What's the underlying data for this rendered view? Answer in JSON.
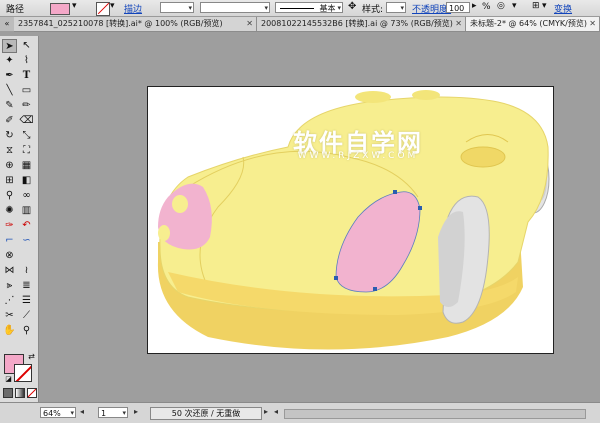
{
  "control_bar": {
    "mode_label": "路径",
    "stroke_label": "描边",
    "stroke_weight": "",
    "brush_label": "基本",
    "style_label": "样式:",
    "opacity_label": "不透明度:",
    "opacity_value": "100",
    "opacity_unit": "%",
    "transform_label": "变换"
  },
  "tabs": [
    {
      "label": "2357841_025210078 [转换].ai* @ 100% (RGB/预览)",
      "active": false
    },
    {
      "label": "20081022145532B6 [转换].ai @ 73% (RGB/预览)",
      "active": false
    },
    {
      "label": "未标题-2* @ 64% (CMYK/预览)",
      "active": true
    }
  ],
  "watermark": {
    "title": "软件自学网",
    "subtitle": "WWW.RJZXW.COM"
  },
  "status_bar": {
    "zoom": "64%",
    "page": "1",
    "status_text": "50 次还原 / 无重做"
  },
  "colors": {
    "fill_swatch": "#f4a8c8",
    "car_body": "#f7ee8f",
    "car_shadow": "#f0d262",
    "headlight": "#f2b3cf",
    "wheel": "#e3e3e3",
    "anchor": "#2a5db0"
  }
}
